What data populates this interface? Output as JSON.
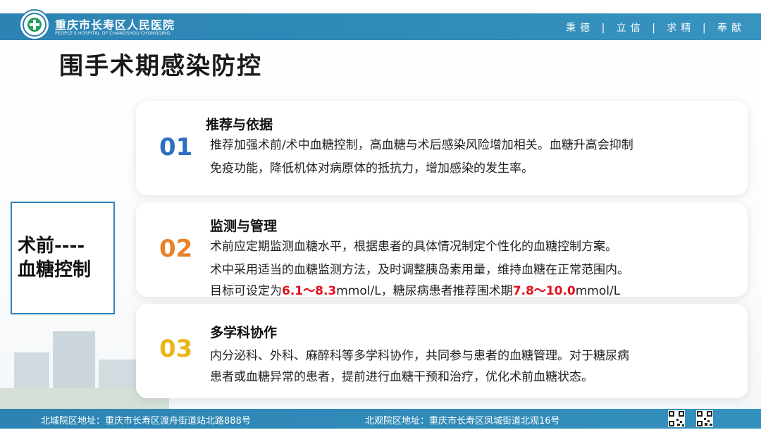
{
  "header": {
    "hospital_name": "重庆市长寿区人民医院",
    "hospital_name_en": "PEOPLE'S HOSPITAL OF CHANGSHOU CHONGQING",
    "motto": "秉德 | 立信 | 求精 | 奉献"
  },
  "title": "围手术期感染防控",
  "side_label": {
    "line1": "术前----",
    "line2": "血糖控制"
  },
  "cards": [
    {
      "number": "01",
      "number_color": "#2d6fc0",
      "heading": "推荐与依据",
      "lines": [
        "推荐加强术前/术中血糖控制，高血糖与术后感染风险增加相关。血糖升高会抑制",
        "免疫功能，降低机体对病原体的抵抗力，增加感染的发生率。"
      ]
    },
    {
      "number": "02",
      "number_color": "#e8832a",
      "heading": "监测与管理",
      "lines": [
        "术前应定期监测血糖水平，根据患者的具体情况制定个性化的血糖控制方案。",
        "术中采用适当的血糖监测方法，及时调整胰岛素用量，维持血糖在正常范围内。"
      ],
      "target_line": {
        "prefix": "目标可设定为",
        "range1": "6.1～8.3",
        "mid": "mmol/L，糖尿病患者推荐围术期",
        "range2": "7.8～10.0",
        "suffix": "mmol/L"
      }
    },
    {
      "number": "03",
      "number_color": "#e9b51c",
      "heading": "多学科协作",
      "lines": [
        "内分泌科、外科、麻醉科等多学科协作，共同参与患者的血糖管理。对于糖尿病",
        "患者或血糖异常的患者，提前进行血糖干预和治疗，优化术前血糖状态。"
      ]
    }
  ],
  "footer": {
    "north_address": "北城院区地址：重庆市长寿区渡舟街道站北路888号",
    "south_address": "北观院区地址：重庆市长寿区凤城街道北观16号"
  },
  "colors": {
    "brand_blue": "#2d84b4",
    "highlight_red": "#e3101a"
  },
  "icons": [
    "hospital-logo-icon",
    "qr-code-icon"
  ]
}
